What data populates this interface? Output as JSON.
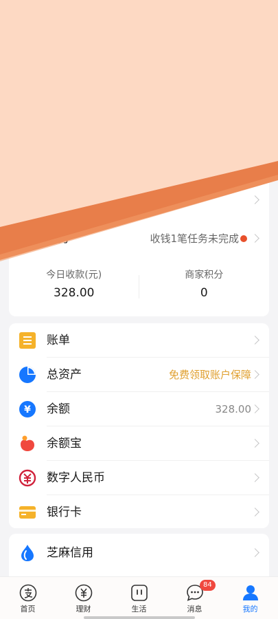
{
  "merchant": {
    "title": "商家服务",
    "status_text": "收钱1笔任务未完成",
    "stats": [
      {
        "label": "今日收款(元)",
        "value": "328.00"
      },
      {
        "label": "商家积分",
        "value": "0"
      }
    ]
  },
  "menu": {
    "items": [
      {
        "label": "账单",
        "right": "",
        "icon": "bill-icon"
      },
      {
        "label": "总资产",
        "right": "免费领取账户保障",
        "icon": "pie-chart-icon"
      },
      {
        "label": "余额",
        "right": "328.00",
        "icon": "yuan-coin-icon"
      },
      {
        "label": "余额宝",
        "right": "",
        "icon": "yuebao-icon"
      },
      {
        "label": "数字人民币",
        "right": "",
        "icon": "digital-rmb-icon"
      },
      {
        "label": "银行卡",
        "right": "",
        "icon": "bank-card-icon"
      }
    ]
  },
  "zhima": {
    "label": "芝麻信用",
    "icon": "sesame-credit-icon"
  },
  "tabbar": {
    "tabs": [
      {
        "label": "首页",
        "icon": "alipay-home-icon"
      },
      {
        "label": "理财",
        "icon": "finance-yuan-icon"
      },
      {
        "label": "生活",
        "icon": "life-icon"
      },
      {
        "label": "消息",
        "icon": "message-icon",
        "badge": "84"
      },
      {
        "label": "我的",
        "icon": "profile-icon",
        "active": true
      }
    ]
  },
  "colors": {
    "accent": "#1677ff",
    "status_dot": "#e8502b",
    "promo": "#e0a030",
    "overlay_fill": "#fdd9c3",
    "overlay_band": "#e87e4a"
  }
}
